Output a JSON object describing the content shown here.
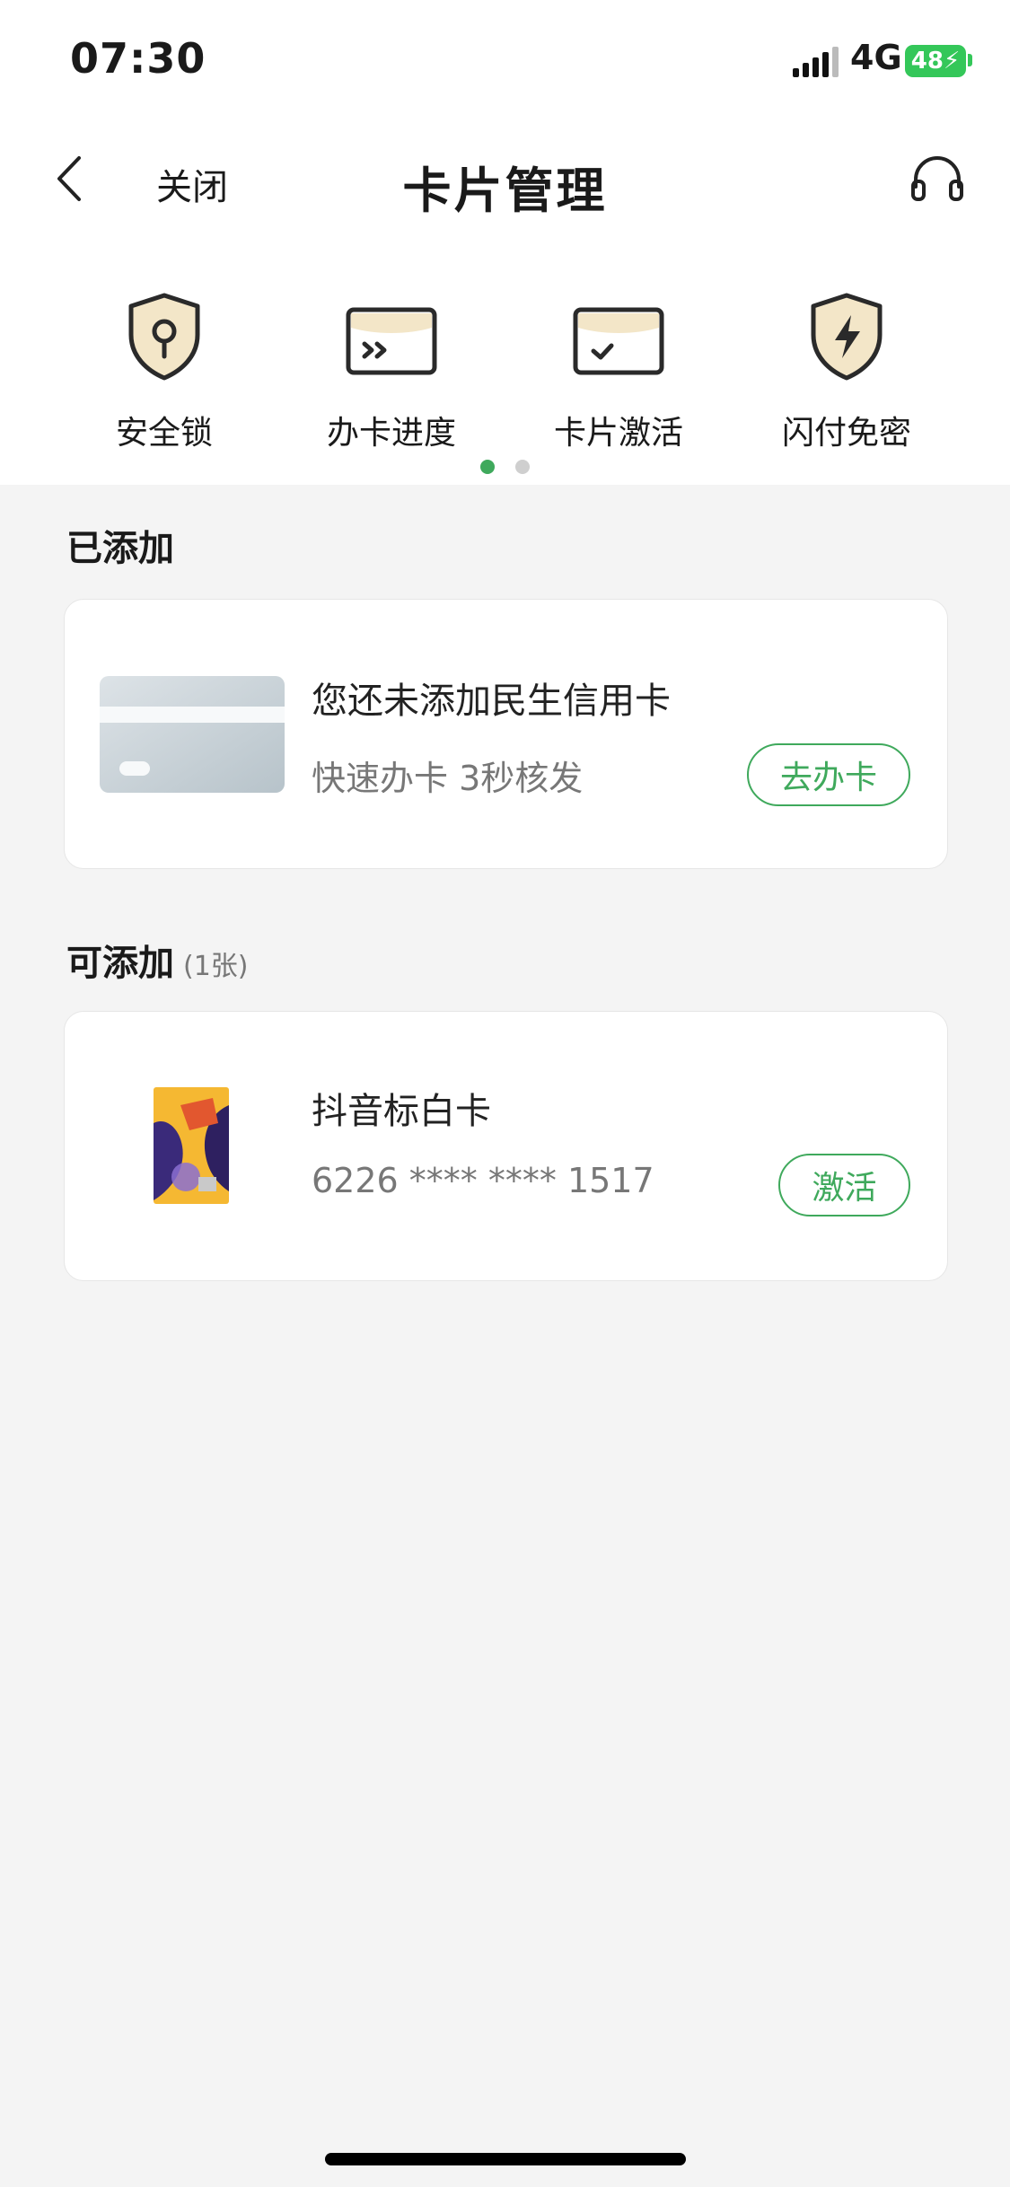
{
  "status_bar": {
    "time": "07:30",
    "network": "4G",
    "battery": "48"
  },
  "nav": {
    "close_label": "关闭",
    "title": "卡片管理"
  },
  "quick_entries": [
    {
      "label": "安全锁",
      "icon": "shield-lock-icon"
    },
    {
      "label": "办卡进度",
      "icon": "card-progress-icon"
    },
    {
      "label": "卡片激活",
      "icon": "card-check-icon"
    },
    {
      "label": "闪付免密",
      "icon": "shield-lightning-icon"
    }
  ],
  "pagination": {
    "pages": 2,
    "current": 1
  },
  "added": {
    "title": "已添加",
    "card": {
      "line1": "您还未添加民生信用卡",
      "line2": "快速办卡 3秒核发",
      "button": "去办卡"
    }
  },
  "addable": {
    "title": "可添加",
    "count": "(1张)",
    "card": {
      "name": "抖音标白卡",
      "number": "6226 **** **** 1517",
      "button": "激活"
    }
  },
  "colors": {
    "accent": "#3fa95c",
    "battery": "#34c759",
    "background": "#f4f4f4"
  }
}
